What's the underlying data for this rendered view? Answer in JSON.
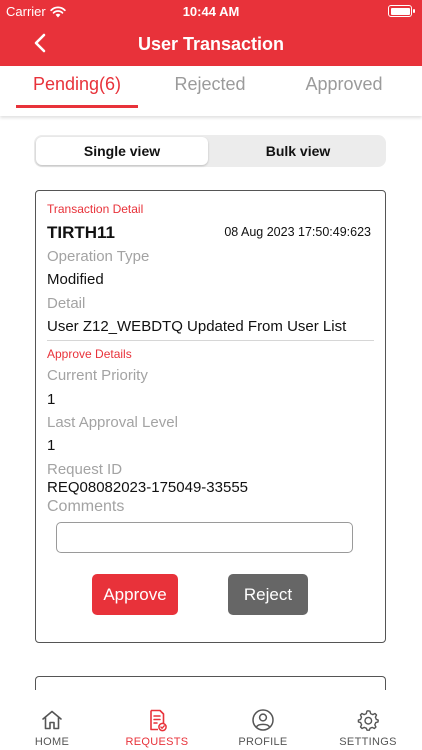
{
  "status_bar": {
    "carrier": "Carrier",
    "time": "10:44 AM"
  },
  "header": {
    "title": "User Transaction"
  },
  "tabs": [
    {
      "label": "Pending(6)",
      "active": true
    },
    {
      "label": "Rejected",
      "active": false
    },
    {
      "label": "Approved",
      "active": false
    }
  ],
  "view_toggle": {
    "single": "Single view",
    "bulk": "Bulk view",
    "selected": "single"
  },
  "transaction": {
    "section_title": "Transaction Detail",
    "id": "TIRTH11",
    "date": "08 Aug 2023 17:50:49:623",
    "operation_type_label": "Operation Type",
    "operation_type": "Modified",
    "detail_label": "Detail",
    "detail": "User Z12_WEBDTQ Updated From  User List",
    "approve_section_title": "Approve Details",
    "current_priority_label": "Current Priority",
    "current_priority": "1",
    "last_approval_level_label": "Last Approval Level",
    "last_approval_level": "1",
    "request_id_label": "Request ID",
    "request_id": "REQ08082023-175049-33555",
    "comments_label": "Comments",
    "comments_value": "",
    "approve_button": "Approve",
    "reject_button": "Reject"
  },
  "bottom_nav": [
    {
      "label": "HOME",
      "icon": "home-icon",
      "active": false
    },
    {
      "label": "REQUESTS",
      "icon": "requests-icon",
      "active": true
    },
    {
      "label": "PROFILE",
      "icon": "profile-icon",
      "active": false
    },
    {
      "label": "SETTINGS",
      "icon": "settings-icon",
      "active": false
    }
  ],
  "colors": {
    "brand": "#e8323a",
    "reject": "#666666",
    "muted_text": "#a3a3a3"
  }
}
